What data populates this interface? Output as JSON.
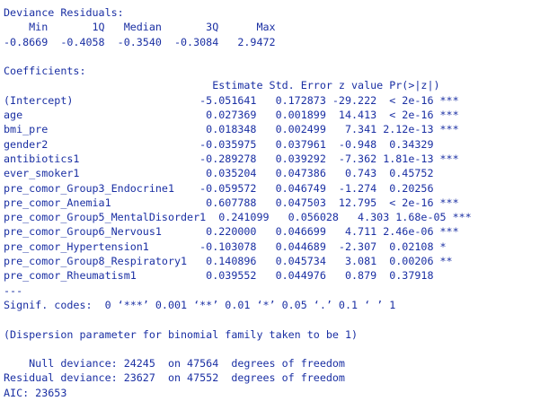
{
  "console": {
    "text_color": "#1a2fa3",
    "background_color": "#ffffff",
    "lines": [
      "Deviance Residuals:",
      "    Min       1Q   Median       3Q      Max",
      "-0.8669  -0.4058  -0.3540  -0.3084   2.9472",
      "",
      "Coefficients:",
      "                                 Estimate Std. Error z value Pr(>|z|)",
      "(Intercept)                    -5.051641   0.172873 -29.222  < 2e-16 ***",
      "age                             0.027369   0.001899  14.413  < 2e-16 ***",
      "bmi_pre                         0.018348   0.002499   7.341 2.12e-13 ***",
      "gender2                        -0.035975   0.037961  -0.948  0.34329",
      "antibiotics1                   -0.289278   0.039292  -7.362 1.81e-13 ***",
      "ever_smoker1                    0.035204   0.047386   0.743  0.45752",
      "pre_comor_Group3_Endocrine1    -0.059572   0.046749  -1.274  0.20256",
      "pre_comor_Anemia1               0.607788   0.047503  12.795  < 2e-16 ***",
      "pre_comor_Group5_MentalDisorder1  0.241099   0.056028   4.303 1.68e-05 ***",
      "pre_comor_Group6_Nervous1       0.220000   0.046699   4.711 2.46e-06 ***",
      "pre_comor_Hypertension1        -0.103078   0.044689  -2.307  0.02108 *",
      "pre_comor_Group8_Respiratory1   0.140896   0.045734   3.081  0.00206 **",
      "pre_comor_Rheumatism1           0.039552   0.044976   0.879  0.37918",
      "---",
      "Signif. codes:  0 ‘***’ 0.001 ‘**’ 0.01 ‘*’ 0.05 ‘.’ 0.1 ‘ ’ 1",
      "",
      "(Dispersion parameter for binomial family taken to be 1)",
      "",
      "    Null deviance: 24245  on 47564  degrees of freedom",
      "Residual deviance: 23627  on 47552  degrees of freedom",
      "AIC: 23653"
    ]
  }
}
